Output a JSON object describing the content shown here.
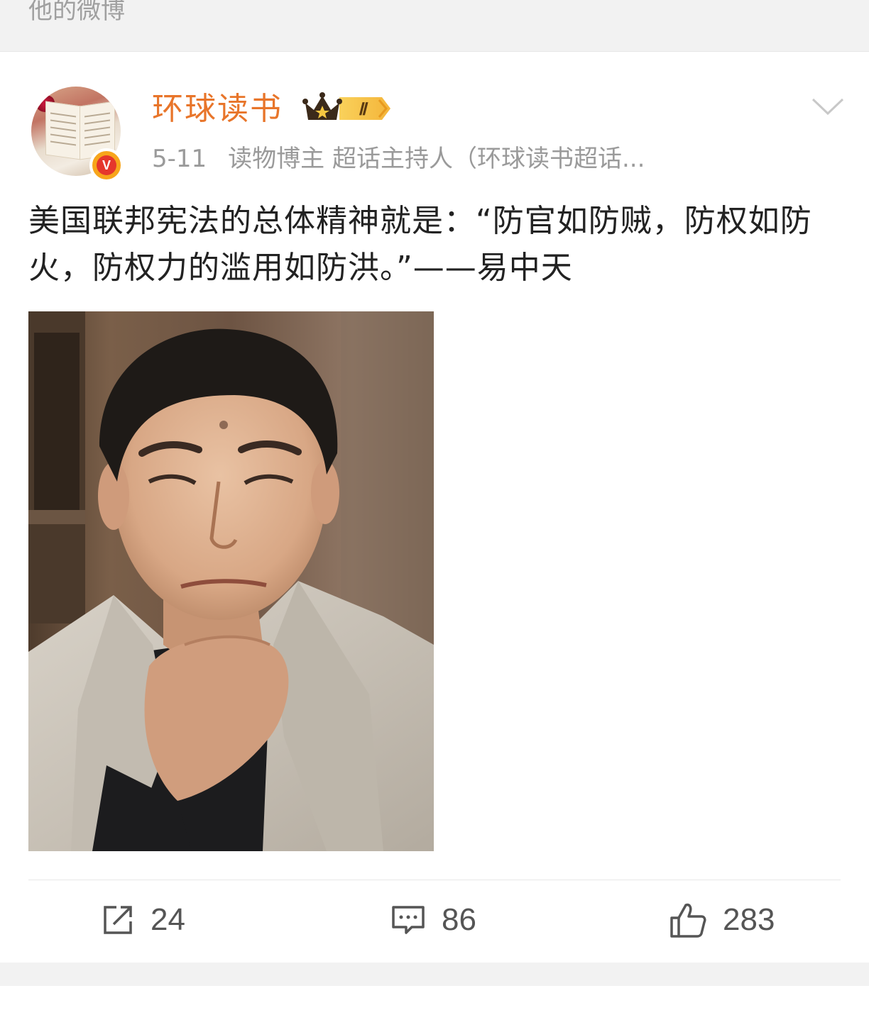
{
  "section": {
    "title": "他的微博"
  },
  "post": {
    "author": "环球读书",
    "vip_level": "Ⅱ",
    "verified_mark": "V",
    "date": "5-11",
    "description": "读物博主 超话主持人（环球读书超话...",
    "text": "美国联邦宪法的总体精神就是：“防官如防贼，防权如防火，防权力的滥用如防洪。”——易中天"
  },
  "actions": {
    "repost_count": "24",
    "comment_count": "86",
    "like_count": "283"
  },
  "icons": {
    "more": "chevron-down-icon",
    "repost": "repost-icon",
    "comment": "comment-icon",
    "like": "thumbs-up-icon",
    "vip": "crown-icon"
  },
  "colors": {
    "username": "#e8752a",
    "meta": "#9a9a9a",
    "verified": "#f7a51b",
    "background": "#f2f2f2"
  }
}
